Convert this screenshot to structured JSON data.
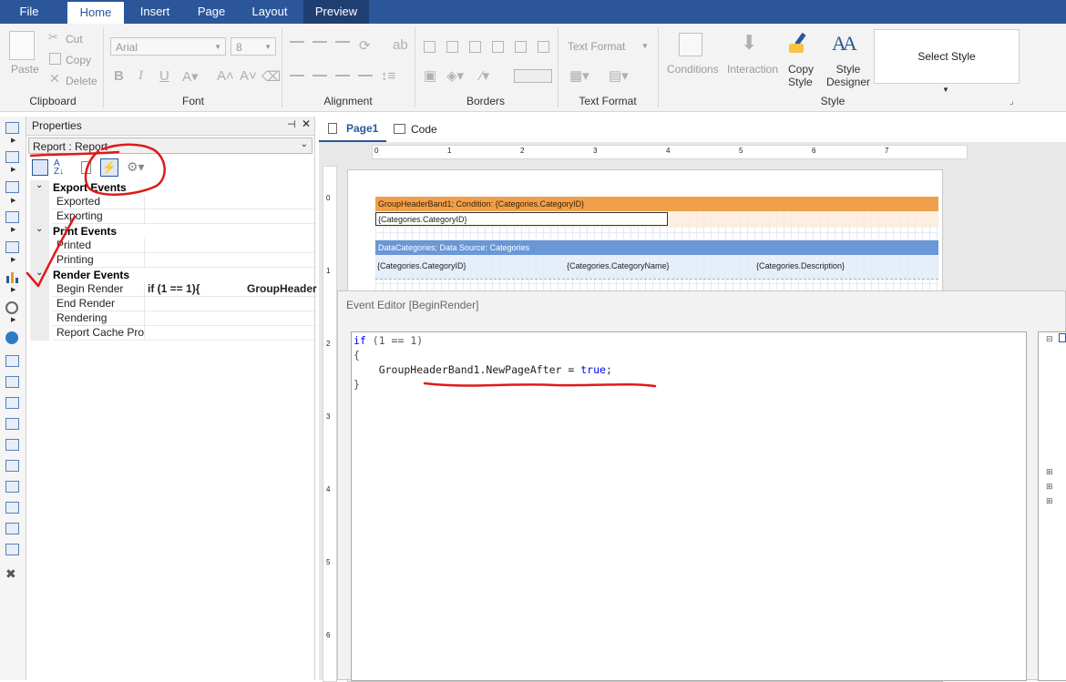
{
  "tabs": [
    {
      "label": "File"
    },
    {
      "label": "Home"
    },
    {
      "label": "Insert"
    },
    {
      "label": "Page"
    },
    {
      "label": "Layout"
    },
    {
      "label": "Preview"
    }
  ],
  "ribbon": {
    "clipboard": {
      "paste": "Paste",
      "cut": "Cut",
      "copy": "Copy",
      "delete": "Delete",
      "label": "Clipboard"
    },
    "font": {
      "family": "Arial",
      "size": "8",
      "label": "Font"
    },
    "alignment": {
      "label": "Alignment"
    },
    "borders": {
      "label": "Borders"
    },
    "text_format": {
      "combo": "Text Format",
      "label": "Text Format"
    },
    "style": {
      "conditions": "Conditions",
      "interaction": "Interaction",
      "copy_style_1": "Copy",
      "copy_style_2": "Style",
      "style_designer_1": "Style",
      "style_designer_2": "Designer",
      "select_style": "Select Style",
      "label": "Style"
    }
  },
  "properties": {
    "title": "Properties",
    "selector": "Report : Report",
    "categories": [
      {
        "name": "Export  Events",
        "items": [
          {
            "name": "Exported",
            "value": ""
          },
          {
            "name": "Exporting",
            "value": ""
          }
        ]
      },
      {
        "name": "Print  Events",
        "items": [
          {
            "name": "Printed",
            "value": ""
          },
          {
            "name": "Printing",
            "value": ""
          }
        ]
      },
      {
        "name": "Render  Events",
        "items": [
          {
            "name": "Begin Render",
            "value": "if (1 == 1){",
            "value2": "GroupHeader"
          },
          {
            "name": "End Render",
            "value": ""
          },
          {
            "name": "Rendering",
            "value": ""
          },
          {
            "name": "Report Cache Proce",
            "value": ""
          }
        ]
      }
    ]
  },
  "doc_tabs": [
    {
      "label": "Page1"
    },
    {
      "label": "Code"
    }
  ],
  "ruler": {
    "h": [
      "0",
      "1",
      "2",
      "3",
      "4",
      "5",
      "6",
      "7"
    ],
    "v": [
      "0",
      "1",
      "2",
      "3",
      "4",
      "5",
      "6"
    ]
  },
  "report": {
    "group_header": "GroupHeaderBand1; Condition: {Categories.CategoryID}",
    "group_field": "{Categories.CategoryID}",
    "data_band": "DataCategories; Data Source: Categories",
    "data_fields": [
      "{Categories.CategoryID}",
      "{Categories.CategoryName}",
      "{Categories.Description}"
    ]
  },
  "editor": {
    "title": "Event Editor [BeginRender]",
    "code": {
      "l1_kw": "if",
      "l1_rest": " (1 == 1)",
      "l2": "{",
      "l3_a": "    GroupHeaderBand1.NewPageAfter = ",
      "l3_kw": "true",
      "l3_b": ";",
      "l4": "}"
    }
  },
  "colors": {
    "accent": "#2b579a",
    "group_band": "#f0a04b",
    "data_band": "#6a97d6",
    "annotation": "#e01919"
  }
}
